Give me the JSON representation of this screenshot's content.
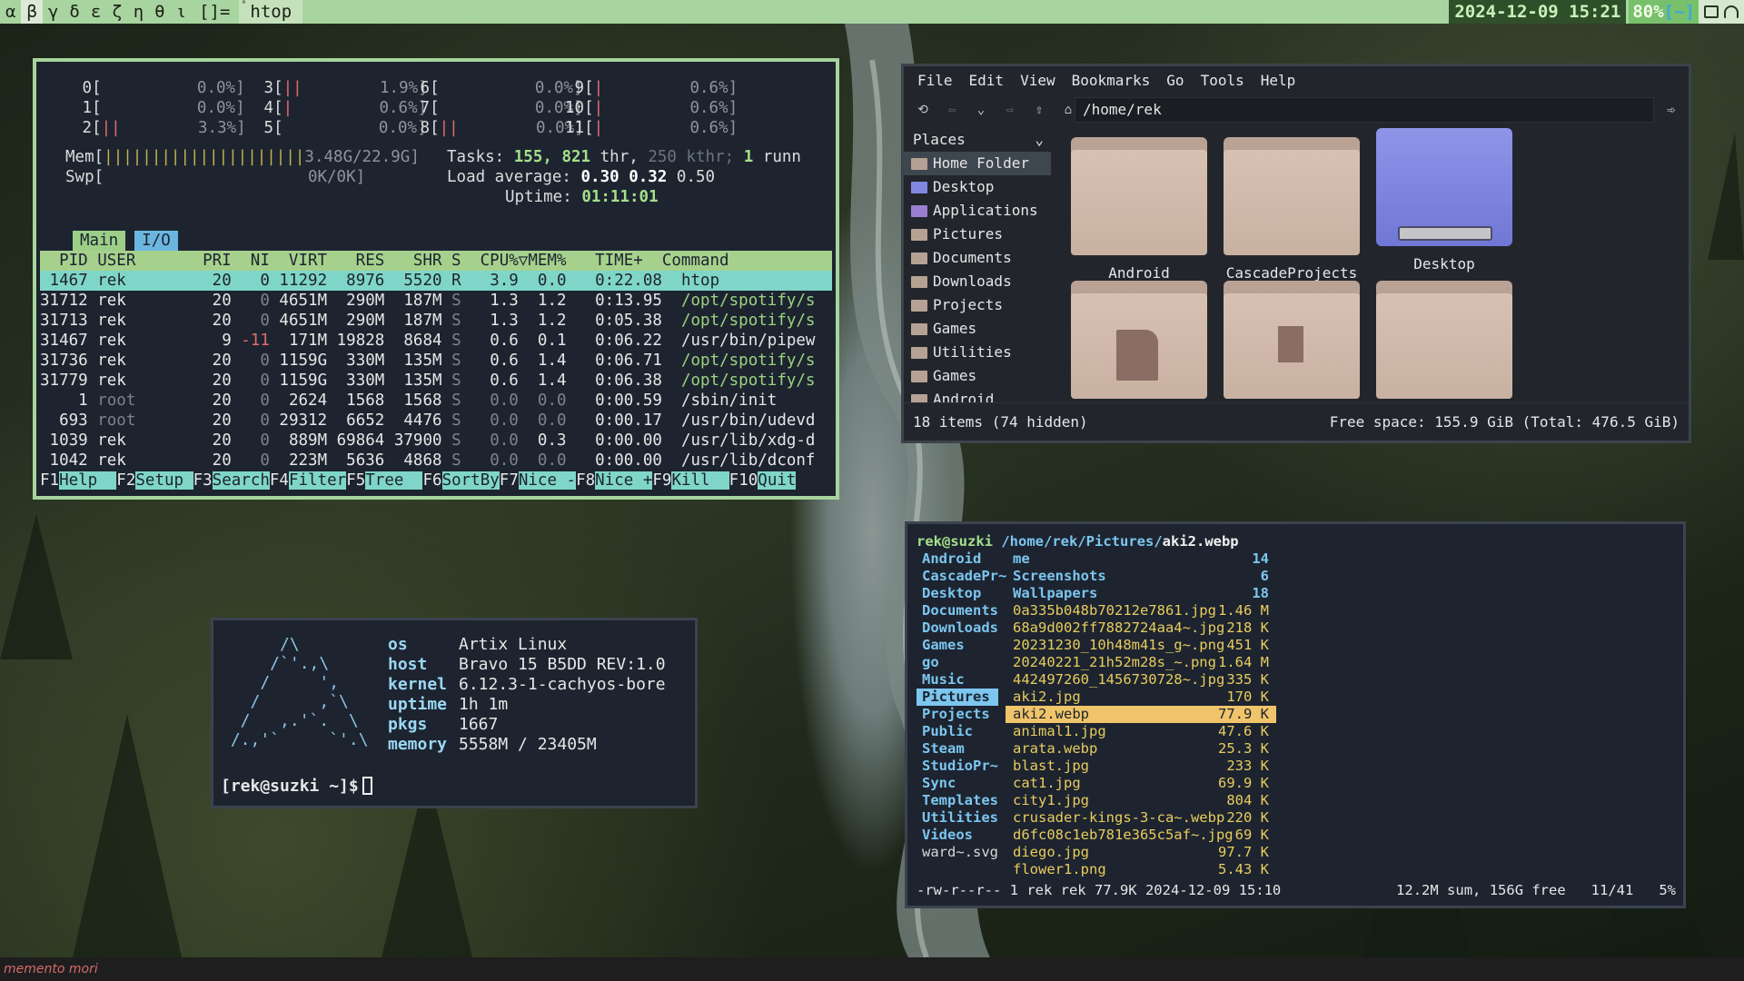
{
  "topbar": {
    "workspaces": [
      {
        "sup": "°",
        "label": "α"
      },
      {
        "sup": "°",
        "label": "β"
      },
      {
        "sup": "°",
        "label": "γ"
      },
      {
        "sup": "",
        "label": "δ"
      },
      {
        "sup": "",
        "label": "ε"
      },
      {
        "sup": "",
        "label": "ζ"
      },
      {
        "sup": "",
        "label": "η"
      },
      {
        "sup": "",
        "label": "θ"
      },
      {
        "sup": "°",
        "label": "ι"
      }
    ],
    "active_workspace": "β",
    "layout": "[]=",
    "window_title": "htop",
    "clock": "2024-12-09 15:21",
    "battery": "80%",
    "battery_mark": "[~]"
  },
  "bottombar": {
    "text": "memento mori"
  },
  "htop": {
    "cpu_rows": [
      [
        "0[",
        "0.0%]",
        "3[||",
        "1.9%]",
        "6[",
        "0.0%]",
        "9[|",
        "0.6%]"
      ],
      [
        "1[",
        "0.0%]",
        "4[|",
        "0.6%]",
        "7[",
        "0.0%]",
        "10[|",
        "0.6%]"
      ],
      [
        "2[||",
        "3.3%]",
        "5[",
        "0.0%]",
        "8[||",
        "0.0%]",
        "11[|",
        "0.6%]"
      ]
    ],
    "mem_label": "Mem[",
    "mem_bar": "|||||||||||||||||||||",
    "mem_value": "3.48G/22.9G]",
    "swp_label": "Swp[",
    "swp_value": "0K/0K]",
    "tasks": {
      "label": "Tasks:",
      "count": "155,",
      "thr": "821",
      "thr_label": "thr,",
      "kthr": "250",
      "kthr_label": "kthr;",
      "running": "1",
      "running_label": "runn"
    },
    "load": {
      "label": "Load average:",
      "v1": "0.30",
      "v2": "0.32",
      "v3": "0.50"
    },
    "uptime": {
      "label": "Uptime:",
      "value": "01:11:01"
    },
    "tabs": [
      "Main",
      "I/O"
    ],
    "columns": "  PID USER       PRI  NI  VIRT   RES   SHR S  CPU%▽MEM%   TIME+  Command",
    "processes": [
      {
        "pid": "1467",
        "user": "rek",
        "pri": "20",
        "ni": "0",
        "virt": "11292",
        "res": "8976",
        "shr": "5520",
        "s": "R",
        "cpu": "3.9",
        "mem": "0.0",
        "time": "0:22.08",
        "cmd": "htop"
      },
      {
        "pid": "31712",
        "user": "rek",
        "pri": "20",
        "ni": "0",
        "virt": "4651M",
        "res": "290M",
        "shr": "187M",
        "s": "S",
        "cpu": "1.3",
        "mem": "1.2",
        "time": "0:13.95",
        "cmd": "/opt/spotify/s"
      },
      {
        "pid": "31713",
        "user": "rek",
        "pri": "20",
        "ni": "0",
        "virt": "4651M",
        "res": "290M",
        "shr": "187M",
        "s": "S",
        "cpu": "1.3",
        "mem": "1.2",
        "time": "0:05.38",
        "cmd": "/opt/spotify/s"
      },
      {
        "pid": "31467",
        "user": "rek",
        "pri": "9",
        "ni": "-11",
        "virt": "171M",
        "res": "19828",
        "shr": "8684",
        "s": "S",
        "cpu": "0.6",
        "mem": "0.1",
        "time": "0:06.22",
        "cmd": "/usr/bin/pipew"
      },
      {
        "pid": "31736",
        "user": "rek",
        "pri": "20",
        "ni": "0",
        "virt": "1159G",
        "res": "330M",
        "shr": "135M",
        "s": "S",
        "cpu": "0.6",
        "mem": "1.4",
        "time": "0:06.71",
        "cmd": "/opt/spotify/s"
      },
      {
        "pid": "31779",
        "user": "rek",
        "pri": "20",
        "ni": "0",
        "virt": "1159G",
        "res": "330M",
        "shr": "135M",
        "s": "S",
        "cpu": "0.6",
        "mem": "1.4",
        "time": "0:06.38",
        "cmd": "/opt/spotify/s"
      },
      {
        "pid": "1",
        "user": "root",
        "pri": "20",
        "ni": "0",
        "virt": "2624",
        "res": "1568",
        "shr": "1568",
        "s": "S",
        "cpu": "0.0",
        "mem": "0.0",
        "time": "0:00.59",
        "cmd": "/sbin/init"
      },
      {
        "pid": "693",
        "user": "root",
        "pri": "20",
        "ni": "0",
        "virt": "29312",
        "res": "6652",
        "shr": "4476",
        "s": "S",
        "cpu": "0.0",
        "mem": "0.0",
        "time": "0:00.17",
        "cmd": "/usr/bin/udevd"
      },
      {
        "pid": "1039",
        "user": "rek",
        "pri": "20",
        "ni": "0",
        "virt": "889M",
        "res": "69864",
        "shr": "37900",
        "s": "S",
        "cpu": "0.0",
        "mem": "0.3",
        "time": "0:00.00",
        "cmd": "/usr/lib/xdg-d"
      },
      {
        "pid": "1042",
        "user": "rek",
        "pri": "20",
        "ni": "0",
        "virt": "223M",
        "res": "5636",
        "shr": "4868",
        "s": "S",
        "cpu": "0.0",
        "mem": "0.0",
        "time": "0:00.00",
        "cmd": "/usr/lib/dconf"
      }
    ],
    "fkeys": [
      {
        "k": "F1",
        "l": "Help  "
      },
      {
        "k": "F2",
        "l": "Setup "
      },
      {
        "k": "F3",
        "l": "Search"
      },
      {
        "k": "F4",
        "l": "Filter"
      },
      {
        "k": "F5",
        "l": "Tree  "
      },
      {
        "k": "F6",
        "l": "SortBy"
      },
      {
        "k": "F7",
        "l": "Nice -"
      },
      {
        "k": "F8",
        "l": "Nice +"
      },
      {
        "k": "F9",
        "l": "Kill  "
      },
      {
        "k": "F10",
        "l": "Quit"
      }
    ]
  },
  "filemanager": {
    "menu": [
      "File",
      "Edit",
      "View",
      "Bookmarks",
      "Go",
      "Tools",
      "Help"
    ],
    "toolbar_icons": [
      "refresh-icon",
      "back-icon",
      "dropdown-icon",
      "forward-icon",
      "up-icon",
      "home-icon"
    ],
    "path": "/home/rek",
    "places_label": "Places",
    "places": [
      "Home Folder",
      "Desktop",
      "Applications",
      "Pictures",
      "Documents",
      "Downloads",
      "Projects",
      "Games",
      "Utilities",
      "Games",
      "Android"
    ],
    "selected_place": "Home Folder",
    "folders": [
      "Android",
      "CascadeProjects",
      "Desktop",
      "",
      "",
      ""
    ],
    "status_left": "18 items (74 hidden)",
    "status_right": "Free space: 155.9 GiB (Total: 476.5 GiB)"
  },
  "fetch": {
    "logo": "      /\\\n     /`'.,\\\n    /     ',\n   /      ,`\\\n  /   ,.'`.  \\\n /.,'`     `'.\\",
    "rows": [
      {
        "k": "os",
        "v": "Artix Linux"
      },
      {
        "k": "host",
        "v": "Bravo 15 B5DD REV:1.0"
      },
      {
        "k": "kernel",
        "v": "6.12.3-1-cachyos-bore"
      },
      {
        "k": "uptime",
        "v": "1h 1m"
      },
      {
        "k": "pkgs",
        "v": "1667"
      },
      {
        "k": "memory",
        "v": "5558M / 23405M"
      }
    ],
    "prompt": "[rek@suzki ~]$"
  },
  "ranger": {
    "user_host": "rek@suzki",
    "path": "/home/rek/Pictures/",
    "file": "aki2.webp",
    "col1": [
      "Android",
      "CascadePr~",
      "Desktop",
      "Documents",
      "Downloads",
      "Games",
      "go",
      "Music",
      "Pictures",
      "Projects",
      "Public",
      "Steam",
      "StudioPr~",
      "Sync",
      "Templates",
      "Utilities",
      "Videos",
      "ward~.svg"
    ],
    "col1_selected": "Pictures",
    "col2": [
      {
        "name": "me",
        "size": "14",
        "type": "dir"
      },
      {
        "name": "Screenshots",
        "size": "6",
        "type": "dir"
      },
      {
        "name": "Wallpapers",
        "size": "18",
        "type": "dir"
      },
      {
        "name": "0a335b048b70212e7861.jpg",
        "size": "1.46 M",
        "type": "img"
      },
      {
        "name": "68a9d002ff7882724aa4~.jpg",
        "size": "218 K",
        "type": "img"
      },
      {
        "name": "20231230_10h48m41s_g~.png",
        "size": "451 K",
        "type": "img"
      },
      {
        "name": "20240221_21h52m28s_~.png",
        "size": "1.64 M",
        "type": "img"
      },
      {
        "name": "442497260_1456730728~.jpg",
        "size": "335 K",
        "type": "img"
      },
      {
        "name": "aki2.jpg",
        "size": "170 K",
        "type": "img"
      },
      {
        "name": "aki2.webp",
        "size": "77.9 K",
        "type": "sel"
      },
      {
        "name": "animal1.jpg",
        "size": "47.6 K",
        "type": "img"
      },
      {
        "name": "arata.webp",
        "size": "25.3 K",
        "type": "img"
      },
      {
        "name": "blast.jpg",
        "size": "233 K",
        "type": "img"
      },
      {
        "name": "cat1.jpg",
        "size": "69.9 K",
        "type": "img"
      },
      {
        "name": "city1.jpg",
        "size": "804 K",
        "type": "img"
      },
      {
        "name": "crusader-kings-3-ca~.webp",
        "size": "220 K",
        "type": "img"
      },
      {
        "name": "d6fc08c1eb781e365c5af~.jpg",
        "size": "69 K",
        "type": "img"
      },
      {
        "name": "diego.jpg",
        "size": "97.7 K",
        "type": "img"
      },
      {
        "name": "flower1.png",
        "size": "5.43 K",
        "type": "img"
      }
    ],
    "foot_left": "-rw-r--r-- 1 rek rek 77.9K 2024-12-09 15:10",
    "foot_right": "12.2M sum, 156G free   11/41   5%"
  }
}
